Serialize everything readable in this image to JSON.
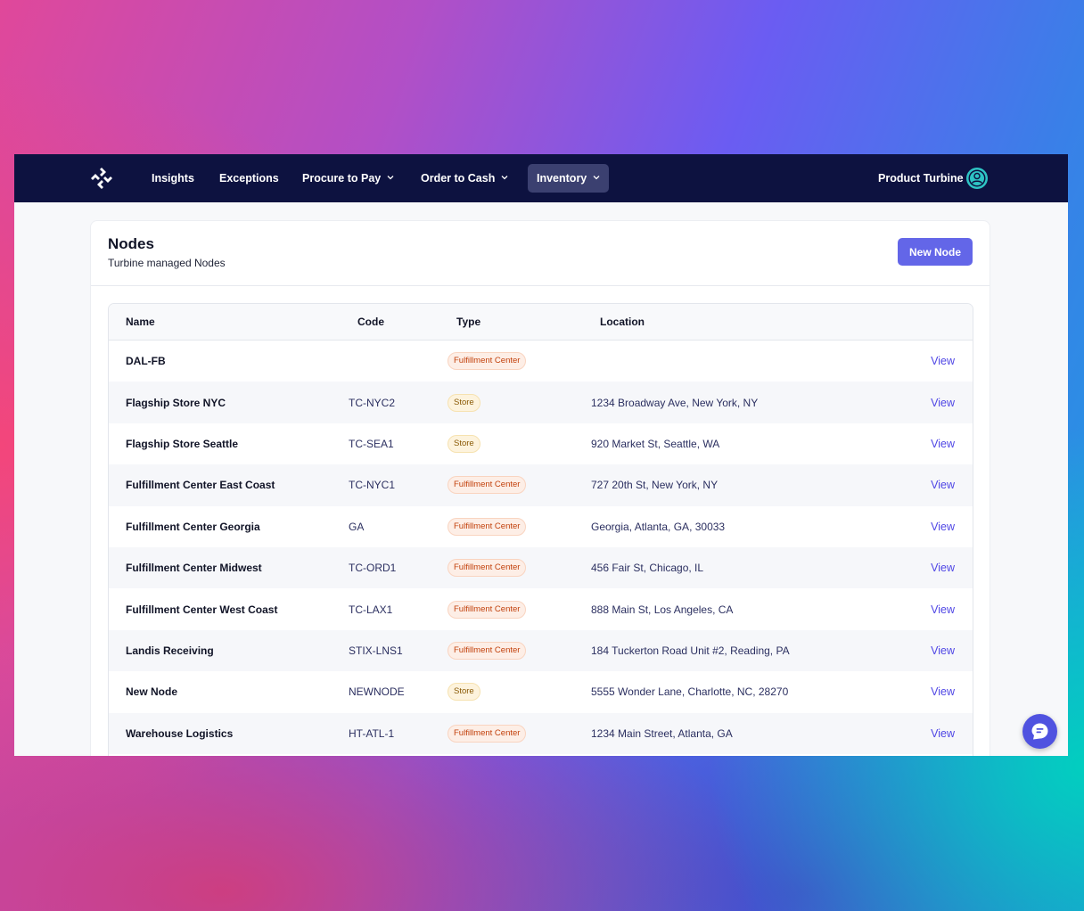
{
  "nav": {
    "items": [
      {
        "label": "Insights",
        "dropdown": false,
        "active": false
      },
      {
        "label": "Exceptions",
        "dropdown": false,
        "active": false
      },
      {
        "label": "Procure to Pay",
        "dropdown": true,
        "active": false
      },
      {
        "label": "Order to Cash",
        "dropdown": true,
        "active": false
      },
      {
        "label": "Inventory",
        "dropdown": true,
        "active": true
      }
    ],
    "user_name": "Product Turbine",
    "logo_icon": "turbine-logo-icon",
    "avatar_icon": "user-avatar-icon"
  },
  "page": {
    "title": "Nodes",
    "subtitle": "Turbine managed Nodes",
    "new_button_label": "New Node"
  },
  "table": {
    "columns": [
      "Name",
      "Code",
      "Type",
      "Location",
      ""
    ],
    "action_label": "View",
    "rows": [
      {
        "name": "DAL-FB",
        "code": "",
        "type": "Fulfillment Center",
        "type_kind": "fc",
        "location": ""
      },
      {
        "name": "Flagship Store NYC",
        "code": "TC-NYC2",
        "type": "Store",
        "type_kind": "store",
        "location": "1234 Broadway Ave, New York, NY"
      },
      {
        "name": "Flagship Store Seattle",
        "code": "TC-SEA1",
        "type": "Store",
        "type_kind": "store",
        "location": "920 Market St, Seattle, WA"
      },
      {
        "name": "Fulfillment Center East Coast",
        "code": "TC-NYC1",
        "type": "Fulfillment Center",
        "type_kind": "fc",
        "location": "727 20th St, New York, NY"
      },
      {
        "name": "Fulfillment Center Georgia",
        "code": "GA",
        "type": "Fulfillment Center",
        "type_kind": "fc",
        "location": "Georgia, Atlanta, GA, 30033"
      },
      {
        "name": "Fulfillment Center Midwest",
        "code": "TC-ORD1",
        "type": "Fulfillment Center",
        "type_kind": "fc",
        "location": "456 Fair St, Chicago, IL"
      },
      {
        "name": "Fulfillment Center West Coast",
        "code": "TC-LAX1",
        "type": "Fulfillment Center",
        "type_kind": "fc",
        "location": "888 Main St, Los Angeles, CA"
      },
      {
        "name": "Landis Receiving",
        "code": "STIX-LNS1",
        "type": "Fulfillment Center",
        "type_kind": "fc",
        "location": "184 Tuckerton Road Unit #2, Reading, PA"
      },
      {
        "name": "New Node",
        "code": "NEWNODE",
        "type": "Store",
        "type_kind": "store",
        "location": "5555 Wonder Lane, Charlotte, NC, 28270"
      },
      {
        "name": "Warehouse Logistics",
        "code": "HT-ATL-1",
        "type": "Fulfillment Center",
        "type_kind": "fc",
        "location": "1234 Main Street, Atlanta, GA"
      }
    ]
  },
  "chat": {
    "icon": "chat-bubble-icon"
  },
  "colors": {
    "nav_bg": "#0d1240",
    "accent": "#6366e8",
    "link": "#4f46e5",
    "badge_fc": "#c2410c",
    "badge_store": "#8a5a06"
  }
}
